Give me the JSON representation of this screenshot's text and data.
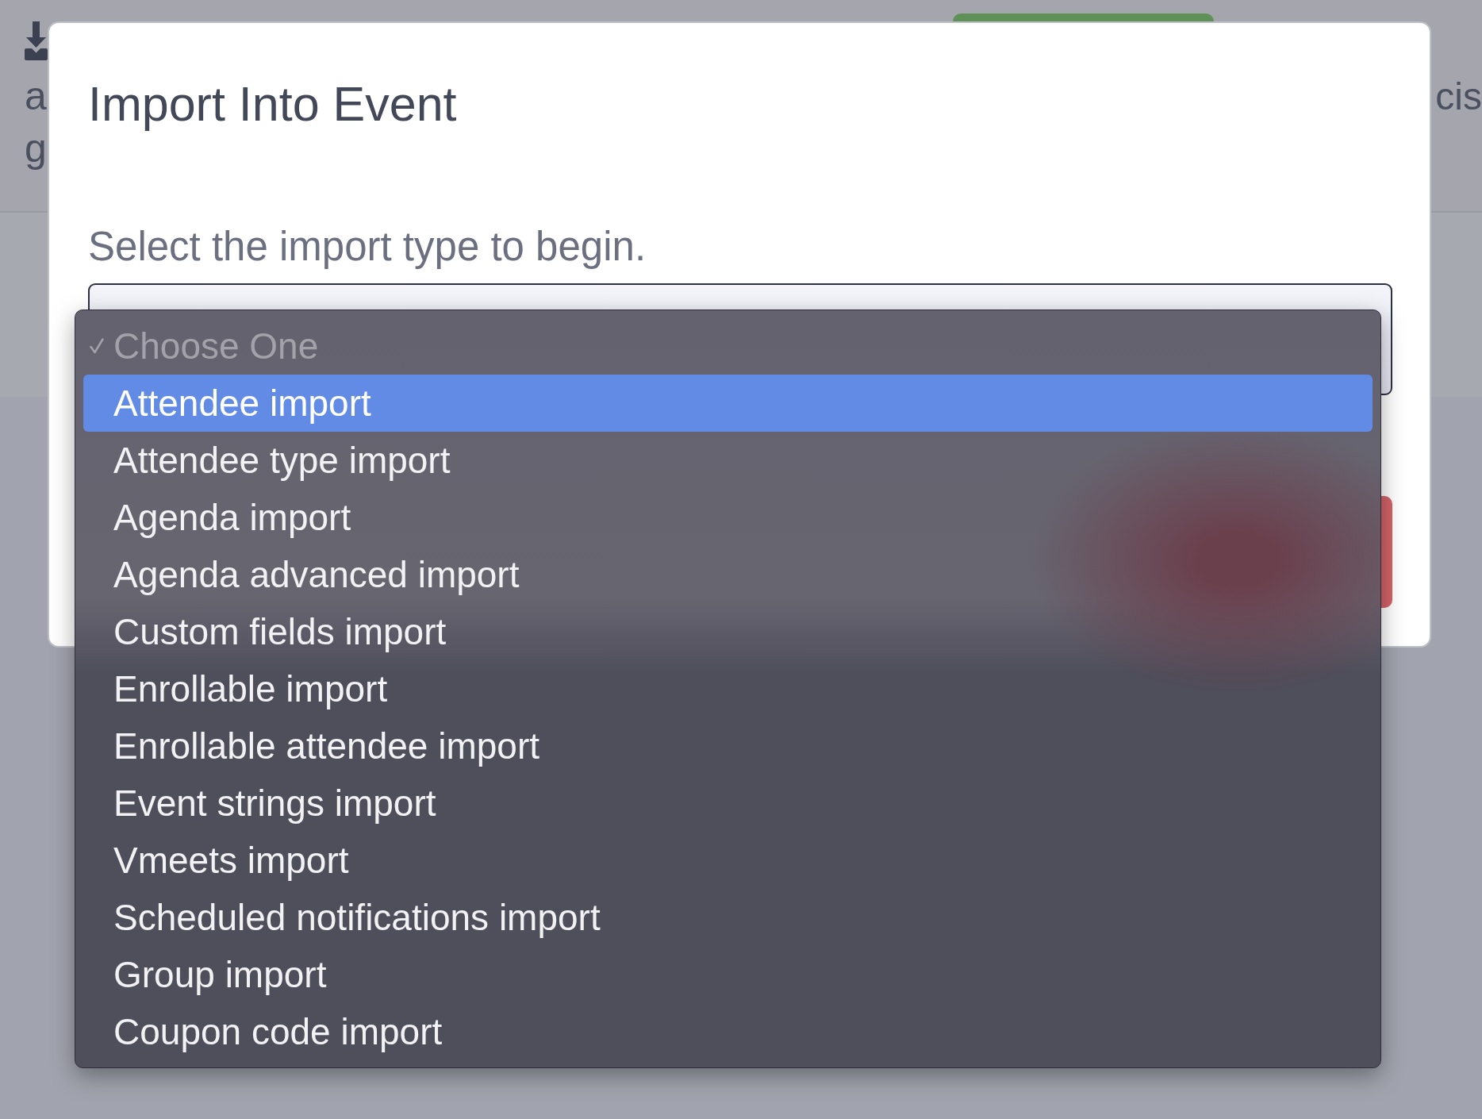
{
  "background_page": {
    "left_text": [
      "a",
      "g"
    ],
    "right_text": [
      "cis"
    ]
  },
  "dialog": {
    "title": "Import Into Event",
    "prompt": "Select the import type to begin.",
    "import_type_select": {
      "expanded": true,
      "options": [
        {
          "label": "Choose One",
          "selected": true,
          "highlighted": false,
          "disabled": true
        },
        {
          "label": "Attendee import",
          "selected": false,
          "highlighted": true,
          "disabled": false
        },
        {
          "label": "Attendee type import",
          "selected": false,
          "highlighted": false,
          "disabled": false
        },
        {
          "label": "Agenda import",
          "selected": false,
          "highlighted": false,
          "disabled": false
        },
        {
          "label": "Agenda advanced import",
          "selected": false,
          "highlighted": false,
          "disabled": false
        },
        {
          "label": "Custom fields import",
          "selected": false,
          "highlighted": false,
          "disabled": false
        },
        {
          "label": "Enrollable import",
          "selected": false,
          "highlighted": false,
          "disabled": false
        },
        {
          "label": "Enrollable attendee import",
          "selected": false,
          "highlighted": false,
          "disabled": false
        },
        {
          "label": "Event strings import",
          "selected": false,
          "highlighted": false,
          "disabled": false
        },
        {
          "label": "Vmeets import",
          "selected": false,
          "highlighted": false,
          "disabled": false
        },
        {
          "label": "Scheduled notifications import",
          "selected": false,
          "highlighted": false,
          "disabled": false
        },
        {
          "label": "Group import",
          "selected": false,
          "highlighted": false,
          "disabled": false
        },
        {
          "label": "Coupon code import",
          "selected": false,
          "highlighted": false,
          "disabled": false
        }
      ]
    }
  }
}
